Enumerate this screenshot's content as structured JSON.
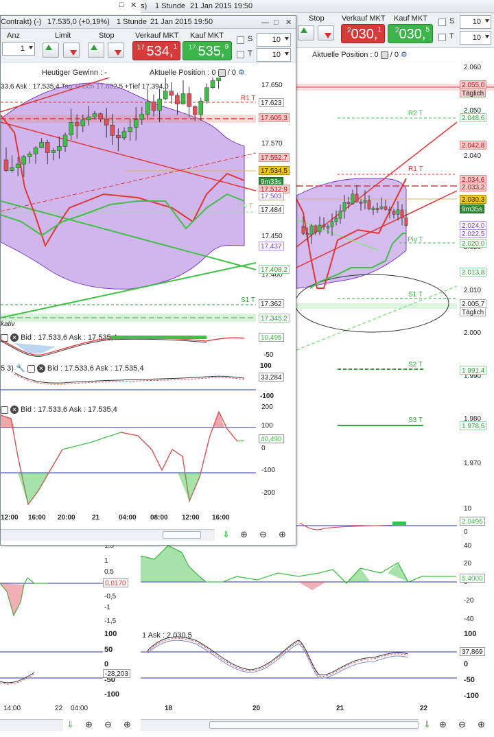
{
  "back_window": {
    "title_partial": "s)",
    "title_timeframe": "1 Stunde",
    "title_datetime": "21 Jan 2015 19:50",
    "toolbar": {
      "stop_label": "Stop",
      "sell_label": "Verkauf MKT",
      "buy_label": "Kauf MKT",
      "sell_price": {
        "small": "2",
        "main": "030,",
        "sup": "1"
      },
      "buy_price": {
        "small": "2",
        "main": "030,",
        "sup": "5"
      },
      "s_label": "S",
      "t_label": "T",
      "s_qty": "10",
      "t_qty": "10"
    },
    "position_label": "Aktuelle Position : 0",
    "position_suffix": "/ 0",
    "price_axis": [
      "2.060",
      "2.050",
      "2.040",
      "2.030",
      "2.020",
      "2.010",
      "2.000",
      "1.990",
      "1.980",
      "1.970"
    ],
    "tags": [
      {
        "text": "2.055,0",
        "kind": "red"
      },
      {
        "text": "Täglich",
        "kind": "redsub"
      },
      {
        "text": "2.048,6",
        "kind": "green"
      },
      {
        "text": "2.042,8",
        "kind": "red"
      },
      {
        "text": "2.034,6",
        "kind": "red"
      },
      {
        "text": "2.033,2",
        "kind": "red"
      },
      {
        "text": "2.030,3",
        "kind": "yellow"
      },
      {
        "text": "9m35s",
        "kind": "dark"
      },
      {
        "text": "2.024,0",
        "kind": "purple"
      },
      {
        "text": "2.022,5",
        "kind": "purple"
      },
      {
        "text": "2.020,0",
        "kind": "green"
      },
      {
        "text": "2.013,8",
        "kind": "green"
      },
      {
        "text": "2.005,7",
        "kind": "plain"
      },
      {
        "text": "Täglich",
        "kind": "plain"
      },
      {
        "text": "1.991,4",
        "kind": "green"
      },
      {
        "text": "1.978,6",
        "kind": "green"
      }
    ],
    "level_labels": {
      "r2": "R2 T",
      "r1": "R1 T",
      "pv": "Piv T",
      "s1": "S1 T",
      "s2": "S2 T",
      "s3": "S3 T"
    },
    "macd_axis": [
      "10",
      "0"
    ],
    "macd_tag": "2,0496",
    "osc_axis": [
      "40",
      "20",
      "0",
      "-20",
      "-40"
    ],
    "osc_tag": "5,4000",
    "stoch_header": "1 Ask : 2.030,5",
    "stoch_axis": [
      "100",
      "50",
      "0",
      "-50",
      "-100"
    ],
    "stoch_tag": "37,869",
    "time_axis": [
      "18",
      "20",
      "21",
      "22"
    ],
    "left_time_axis": [
      "14:00",
      "22",
      "04:00"
    ],
    "left_osc_axis": [
      "1,5",
      "1",
      "0,5",
      "0",
      "-0,5",
      "-1",
      "-1,5"
    ],
    "left_osc_tag": "0,0170",
    "left_stoch_axis": [
      "100",
      "50",
      "0",
      "-50",
      "-100"
    ],
    "left_stoch_tag": "-28,203"
  },
  "front_window": {
    "title_contract": "Contrakt) (-)",
    "title_price": "17.535,0 (+0,19%)",
    "title_timeframe": "1 Stunde",
    "title_datetime": "21 Jan 2015 19:50",
    "toolbar": {
      "anz_label": "Anz",
      "limit_label": "Limit",
      "stop_label": "Stop",
      "sell_label": "Verkauf MKT",
      "buy_label": "Kauf MKT",
      "qty": "1",
      "sell_price": {
        "small": "17.",
        "main": "534,",
        "sup": "1"
      },
      "buy_price": {
        "small": "17.",
        "main": "535,",
        "sup": "9"
      },
      "s_label": "S",
      "t_label": "T",
      "s_qty": "10",
      "t_qty": "10"
    },
    "gain_label": "Heutiger Gewinn : -",
    "position_label": "Aktuelle Position : 0",
    "position_suffix": "/ 0",
    "info_line": "33,6 Ask : 17.535,4 Tag:+Hoch 17.602,5 +Tief 17.394,0",
    "price_axis": [
      "17.650",
      "17.570",
      "17.450",
      "17.400"
    ],
    "tags": [
      {
        "text": "17.623",
        "kind": "plain"
      },
      {
        "text": "17.605,3",
        "kind": "red"
      },
      {
        "text": "17.552,7",
        "kind": "red"
      },
      {
        "text": "17.534,5",
        "kind": "yellow"
      },
      {
        "text": "9m33s",
        "kind": "dark"
      },
      {
        "text": "17.512,9",
        "kind": "red"
      },
      {
        "text": "17.503",
        "kind": "purple"
      },
      {
        "text": "17.484",
        "kind": "plain"
      },
      {
        "text": "17.437",
        "kind": "purple"
      },
      {
        "text": "17.408,2",
        "kind": "green"
      },
      {
        "text": "17.362",
        "kind": "plain"
      },
      {
        "text": "17.345,2",
        "kind": "green"
      }
    ],
    "level_labels": {
      "r1": "R1 T",
      "pv": "Piv T",
      "s1": "S1 T"
    },
    "corner_label": "kativ",
    "macd_header": "Bid : 17.533,6 Ask : 17.535,4",
    "macd_tag": "10,495",
    "macd_axis": [
      "-50"
    ],
    "stoch_header_prefix": "5 3)",
    "stoch_header": "Bid : 17.533,6 Ask : 17.535,4",
    "stoch_axis": [
      "100",
      "-100"
    ],
    "stoch_tag": "33,284",
    "cci_header": "Bid : 17.533,6 Ask : 17.535,4",
    "cci_axis": [
      "200",
      "100",
      "0",
      "-100",
      "-200"
    ],
    "cci_tag": "40,490",
    "time_axis": [
      "12:00",
      "16:00",
      "20:00",
      "21",
      "04:00",
      "08:00",
      "12:00",
      "16:00"
    ]
  },
  "icons": [
    "stop-icon",
    "zoom-fit-icon",
    "zoom-out-icon",
    "zoom-in-icon",
    "settings-icon",
    "wrench-icon",
    "close-icon"
  ],
  "colors": {
    "up": "#3fbf45",
    "down": "#e0505a",
    "bollinger": "#b78fe3",
    "support": "#2e9e3a",
    "resistance": "#e03535",
    "axis_blue": "#2233aa"
  }
}
